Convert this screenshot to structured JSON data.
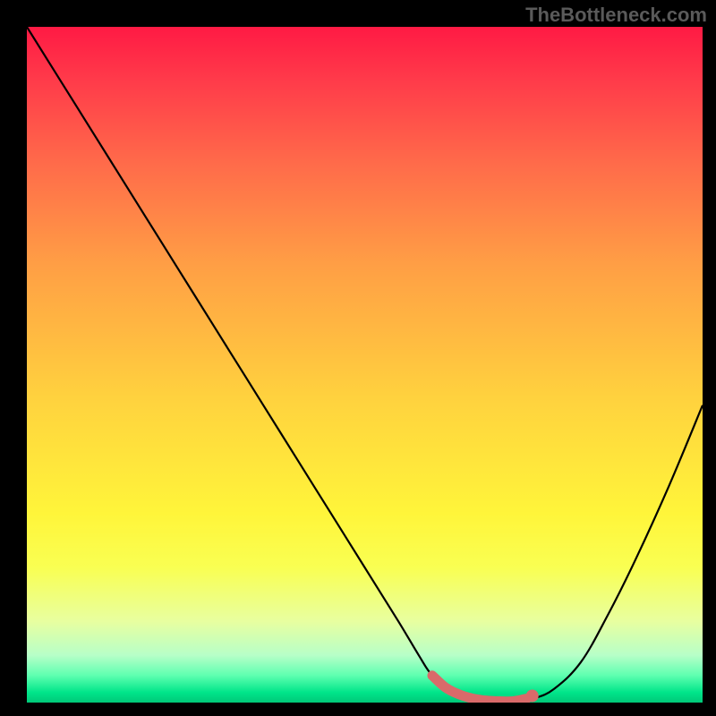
{
  "watermark": "TheBottleneck.com",
  "colors": {
    "background": "#000000",
    "watermark_text": "#5a5a5a",
    "curve": "#000000",
    "marker_stroke": "#d96a6a",
    "marker_fill": "#d96a6a"
  },
  "chart_data": {
    "type": "line",
    "title": "",
    "xlabel": "",
    "ylabel": "",
    "xlim": [
      0,
      100
    ],
    "ylim": [
      0,
      100
    ],
    "grid": false,
    "series": [
      {
        "name": "bottleneck-curve",
        "x": [
          0,
          5,
          10,
          15,
          20,
          25,
          30,
          35,
          40,
          45,
          50,
          55,
          58,
          60,
          63,
          66,
          70,
          73,
          75,
          78,
          82,
          86,
          90,
          95,
          100
        ],
        "y": [
          100,
          92,
          84,
          76,
          68,
          60,
          52,
          44,
          36,
          28,
          20,
          12,
          7,
          4,
          1.5,
          0.6,
          0.2,
          0.2,
          0.6,
          2,
          6,
          13,
          21,
          32,
          44
        ]
      }
    ],
    "markers": {
      "name": "highlight-segment",
      "x": [
        60,
        62,
        64,
        66,
        68,
        70,
        72,
        74
      ],
      "y": [
        4,
        2.2,
        1.2,
        0.6,
        0.3,
        0.2,
        0.2,
        0.6
      ]
    },
    "legend": false
  }
}
